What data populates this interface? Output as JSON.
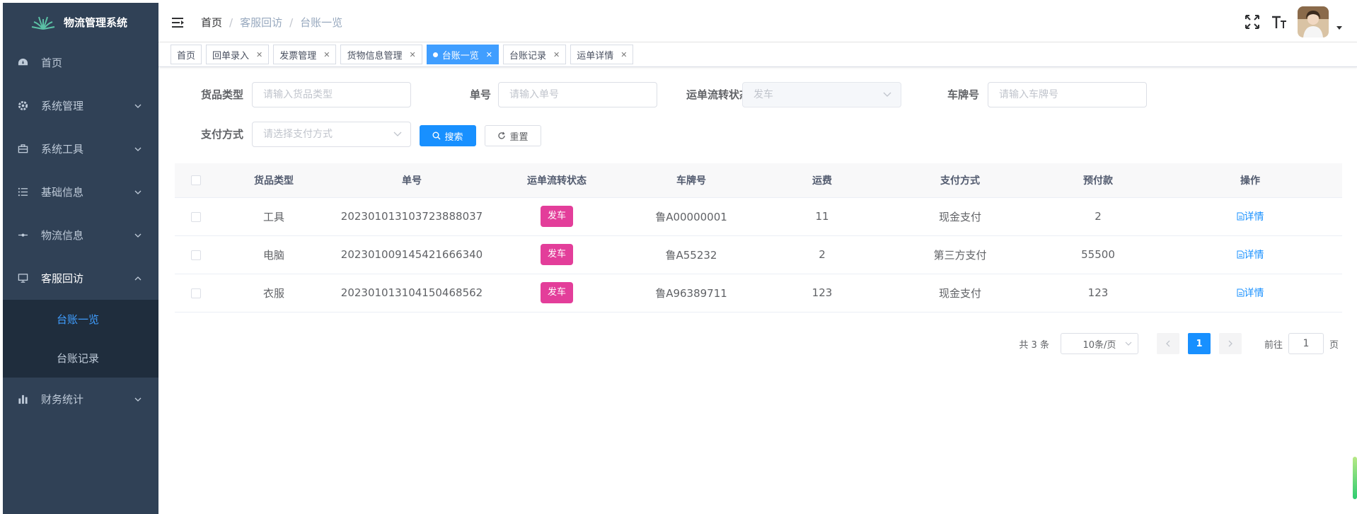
{
  "app": {
    "title": "物流管理系统"
  },
  "sidebar": {
    "items": [
      {
        "label": "首页",
        "icon": "dashboard-icon"
      },
      {
        "label": "系统管理",
        "icon": "gear-icon"
      },
      {
        "label": "系统工具",
        "icon": "toolbox-icon"
      },
      {
        "label": "基础信息",
        "icon": "list-icon"
      },
      {
        "label": "物流信息",
        "icon": "route-icon"
      },
      {
        "label": "客服回访",
        "icon": "monitor-icon"
      },
      {
        "label": "财务统计",
        "icon": "bar-chart-icon"
      }
    ],
    "submenu": [
      {
        "label": "台账一览",
        "active": true
      },
      {
        "label": "台账记录",
        "active": false
      }
    ]
  },
  "breadcrumb": [
    "首页",
    "客服回访",
    "台账一览"
  ],
  "tags": [
    {
      "label": "首页",
      "closable": false
    },
    {
      "label": "回单录入",
      "closable": true
    },
    {
      "label": "发票管理",
      "closable": true
    },
    {
      "label": "货物信息管理",
      "closable": true
    },
    {
      "label": "台账一览",
      "closable": true,
      "active": true
    },
    {
      "label": "台账记录",
      "closable": true
    },
    {
      "label": "运单详情",
      "closable": true
    }
  ],
  "filters": {
    "goods_type": {
      "label": "货品类型",
      "placeholder": "请输入货品类型"
    },
    "order_no": {
      "label": "单号",
      "placeholder": "请输入单号"
    },
    "status": {
      "label": "运单流转状态",
      "value": "发车"
    },
    "plate": {
      "label": "车牌号",
      "placeholder": "请输入车牌号"
    },
    "pay": {
      "label": "支付方式",
      "placeholder": "请选择支付方式"
    },
    "search_label": "搜索",
    "reset_label": "重置"
  },
  "table": {
    "headers": [
      "货品类型",
      "单号",
      "运单流转状态",
      "车牌号",
      "运费",
      "支付方式",
      "预付款",
      "操作"
    ],
    "rows": [
      {
        "goods": "工具",
        "no": "20230101310372388803​7",
        "status": "发车",
        "plate": "鲁A00000001",
        "fee": "11",
        "pay": "现金支付",
        "prepay": "2",
        "action": "详情"
      },
      {
        "goods": "电脑",
        "no": "20230100914542166634​0",
        "status": "发车",
        "plate": "鲁A55232",
        "fee": "2",
        "pay": "第三方支付",
        "prepay": "55500",
        "action": "详情"
      },
      {
        "goods": "衣服",
        "no": "20230101310415046856​2",
        "status": "发车",
        "plate": "鲁A96389711",
        "fee": "123",
        "pay": "现金支付",
        "prepay": "123",
        "action": "详情"
      }
    ]
  },
  "pagination": {
    "total": "共 3 条",
    "page_size": "10条/页",
    "current": "1",
    "goto_prefix": "前往",
    "goto_value": "1",
    "goto_suffix": "页"
  },
  "colors": {
    "sidebar": "#304156",
    "primary": "#1890ff",
    "badge": "#e33e9a"
  }
}
